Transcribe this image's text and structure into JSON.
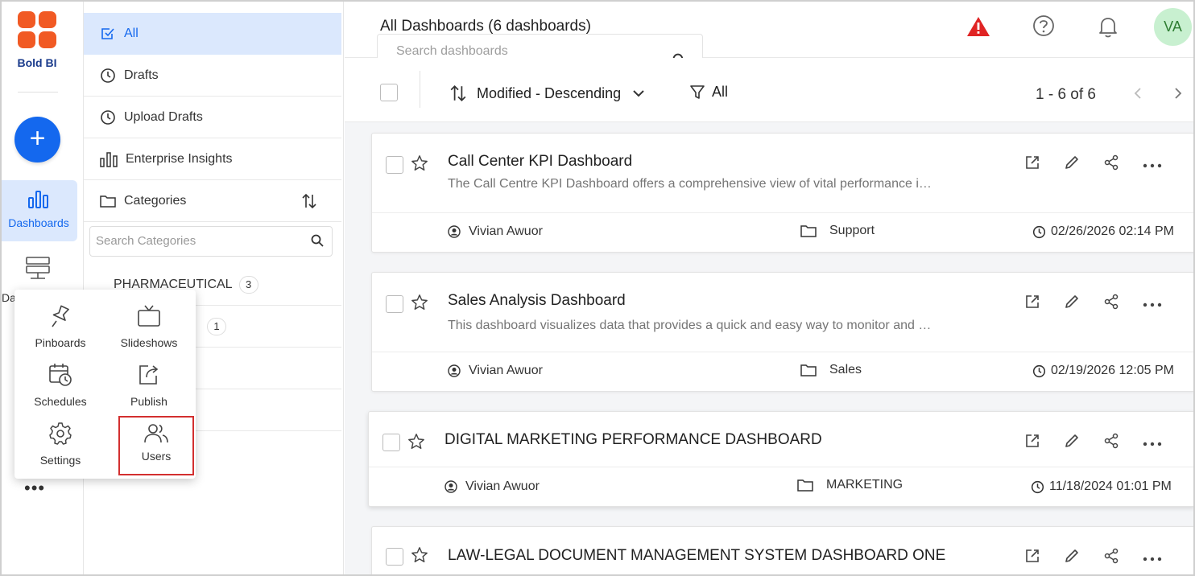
{
  "brand": {
    "name": "Bold BI"
  },
  "rail": {
    "create_symbol": "+",
    "dashboards_label": "Dashboards",
    "datasources_label": "Da",
    "more_symbol": "•••"
  },
  "popup_menu": [
    {
      "label": "Pinboards",
      "icon": "pin-icon"
    },
    {
      "label": "Slideshows",
      "icon": "tv-icon"
    },
    {
      "label": "Schedules",
      "icon": "calendar-clock-icon"
    },
    {
      "label": "Publish",
      "icon": "publish-icon"
    },
    {
      "label": "Settings",
      "icon": "gear-icon"
    },
    {
      "label": "Users",
      "icon": "users-icon",
      "highlighted": true
    }
  ],
  "categories_panel": {
    "nav": [
      {
        "label": "All",
        "icon": "check-square-icon",
        "active": true
      },
      {
        "label": "Drafts",
        "icon": "clock-icon"
      },
      {
        "label": "Upload Drafts",
        "icon": "clock-icon"
      },
      {
        "label": "Enterprise Insights",
        "icon": "bar-chart-icon"
      }
    ],
    "categories_label": "Categories",
    "search_placeholder": "Search Categories",
    "items": [
      {
        "name": "PHARMACEUTICAL",
        "count": "3"
      },
      {
        "name": "",
        "count": "1"
      }
    ]
  },
  "header": {
    "title": "All Dashboards (6 dashboards)",
    "search_placeholder": "Search dashboards",
    "avatar_initials": "VA"
  },
  "toolbar": {
    "sort_label": "Modified - Descending",
    "filter_label": "All",
    "pagination": "1 - 6 of 6"
  },
  "dashboards": [
    {
      "title": "Call Center KPI Dashboard",
      "description": "The Call Centre KPI Dashboard offers a comprehensive view of vital performance i…",
      "owner": "Vivian Awuor",
      "category": "Support",
      "modified": "02/26/2026 02:14 PM"
    },
    {
      "title": "Sales Analysis Dashboard",
      "description": "This dashboard visualizes data that provides a quick and easy way to monitor and …",
      "owner": "Vivian Awuor",
      "category": "Sales",
      "modified": "02/19/2026 12:05 PM"
    },
    {
      "title": "DIGITAL MARKETING PERFORMANCE DASHBOARD",
      "description": "",
      "owner": "Vivian Awuor",
      "category": "MARKETING",
      "modified": "11/18/2024 01:01 PM"
    },
    {
      "title": "LAW-LEGAL DOCUMENT MANAGEMENT SYSTEM DASHBOARD ONE",
      "description": "",
      "owner": "",
      "category": "",
      "modified": ""
    }
  ],
  "colors": {
    "accent": "#1468ee",
    "active_bg": "#dbe8fd",
    "warning": "#e02424",
    "highlight_border": "#d32f2f",
    "avatar_bg": "#c8f0d0"
  }
}
